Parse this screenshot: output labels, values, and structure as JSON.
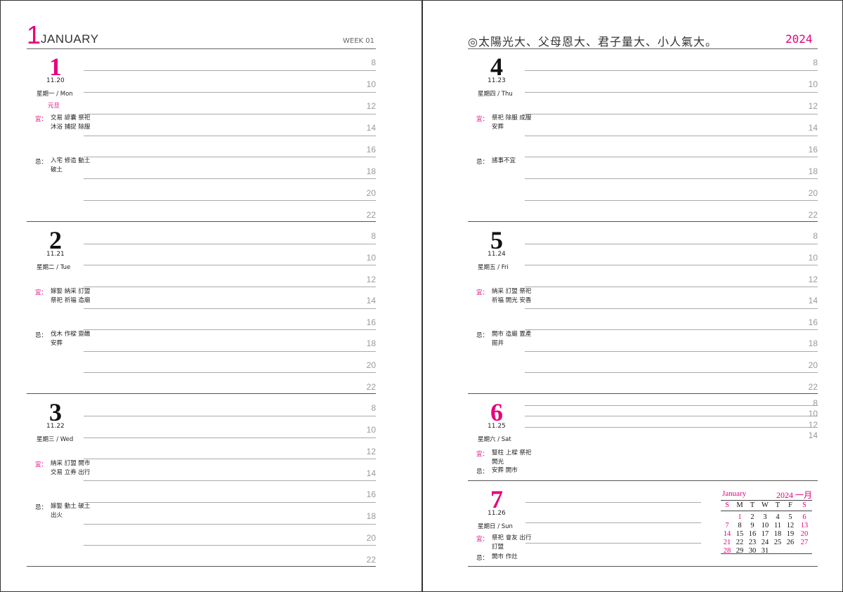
{
  "header": {
    "month_number": "1",
    "month_name": "JANUARY",
    "week": "WEEK 01",
    "motto": "◎太陽光大、父母恩大、君子量大、小人氣大。",
    "year": "2024"
  },
  "hours": [
    "8",
    "10",
    "12",
    "14",
    "16",
    "18",
    "20",
    "22"
  ],
  "hours_short": [
    "8",
    "10",
    "12",
    "14"
  ],
  "days": {
    "d1": {
      "num": "1",
      "lunar": "11.20",
      "weekday": "星期一 / Mon",
      "holiday": "元旦",
      "good_label": "宜：",
      "good": "交易 諺囊 祭祀 沐浴 捕捉 除服",
      "bad_label": "忌：",
      "bad": "入宅 修造 動土 破土"
    },
    "d2": {
      "num": "2",
      "lunar": "11.21",
      "weekday": "星期二 / Tue",
      "good_label": "宜：",
      "good": "嫁娶 納采 訂盟 祭祀 祈福 造廟",
      "bad_label": "忌：",
      "bad": "伐木 作樑 齋醮 安葬"
    },
    "d3": {
      "num": "3",
      "lunar": "11.22",
      "weekday": "星期三 / Wed",
      "good_label": "宜：",
      "good": "納采 訂盟 開市 交易 立券 出行",
      "bad_label": "忌：",
      "bad": "嫁娶 動土 破土 出火"
    },
    "d4": {
      "num": "4",
      "lunar": "11.23",
      "weekday": "星期四 / Thu",
      "good_label": "宜：",
      "good": "祭祀 除服 成服 安葬",
      "bad_label": "忌：",
      "bad": "諸事不宜"
    },
    "d5": {
      "num": "5",
      "lunar": "11.24",
      "weekday": "星期五 / Fri",
      "good_label": "宜：",
      "good": "納采 訂盟 祭祀 祈福 開光 安香",
      "bad_label": "忌：",
      "bad": "開市 造廟 置產 掘井"
    },
    "d6": {
      "num": "6",
      "lunar": "11.25",
      "weekday": "星期六 / Sat",
      "good_label": "宜：",
      "good": "豎柱 上樑 祭祀 開光",
      "bad_label": "忌：",
      "bad": "安葬 開市"
    },
    "d7": {
      "num": "7",
      "lunar": "11.26",
      "weekday": "星期日 / Sun",
      "good_label": "宜：",
      "good": "祭祀 會友 出行 訂盟",
      "bad_label": "忌：",
      "bad": "開市 作灶"
    }
  },
  "minical": {
    "month": "January",
    "year": "2024 一月",
    "dow": [
      "S",
      "M",
      "T",
      "W",
      "T",
      "F",
      "S"
    ],
    "weeks": [
      [
        "",
        "1",
        "2",
        "3",
        "4",
        "5",
        "6"
      ],
      [
        "7",
        "8",
        "9",
        "10",
        "11",
        "12",
        "13"
      ],
      [
        "14",
        "15",
        "16",
        "17",
        "18",
        "19",
        "20"
      ],
      [
        "21",
        "22",
        "23",
        "24",
        "25",
        "26",
        "27"
      ],
      [
        "28",
        "29",
        "30",
        "31",
        "",
        "",
        ""
      ]
    ],
    "highlight_color": "#e6007e"
  }
}
